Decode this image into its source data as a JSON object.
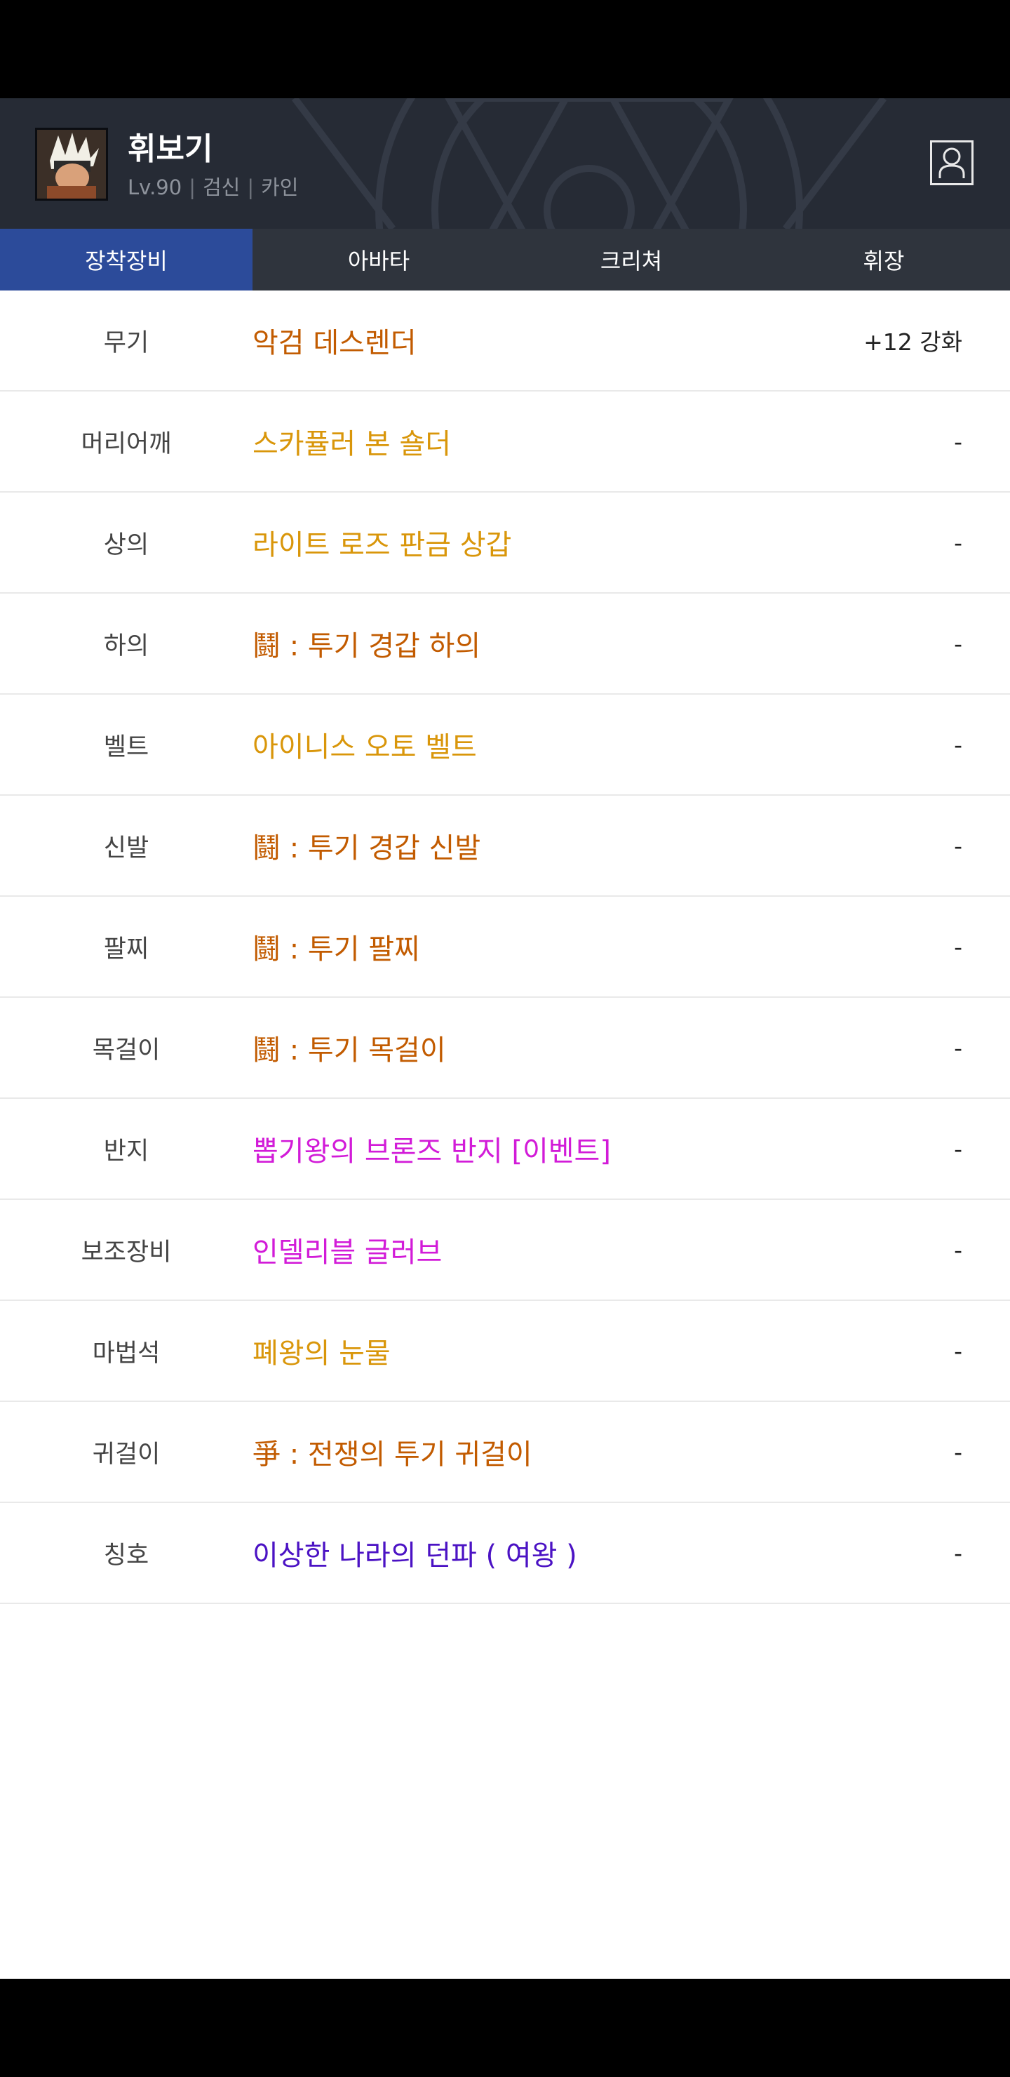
{
  "character": {
    "name": "휘보기",
    "level": "Lv.90",
    "class": "검신",
    "server": "카인",
    "separator": "|"
  },
  "tabs": [
    {
      "label": "장착장비",
      "active": true
    },
    {
      "label": "아바타",
      "active": false
    },
    {
      "label": "크리쳐",
      "active": false
    },
    {
      "label": "휘장",
      "active": false
    }
  ],
  "icons": {
    "avatar": "character-portrait",
    "profile_button": "person-icon"
  },
  "colors": {
    "epic_orange": "#c25b00",
    "legendary_gold": "#d9960a",
    "unique_magenta": "#d21bd8",
    "title_purple": "#4b12c4",
    "tab_active": "#2c4b9a"
  },
  "equipment": [
    {
      "slot": "무기",
      "item": "악검 데스렌더",
      "enhance": "+12 강화",
      "color": "#c25b00"
    },
    {
      "slot": "머리어깨",
      "item": "스카퓰러 본 숄더",
      "enhance": "-",
      "color": "#d9960a"
    },
    {
      "slot": "상의",
      "item": "라이트 로즈 판금 상갑",
      "enhance": "-",
      "color": "#d9960a"
    },
    {
      "slot": "하의",
      "item": "鬪 : 투기 경갑 하의",
      "enhance": "-",
      "color": "#c25b00"
    },
    {
      "slot": "벨트",
      "item": "아이니스 오토 벨트",
      "enhance": "-",
      "color": "#d9960a"
    },
    {
      "slot": "신발",
      "item": "鬪 : 투기 경갑 신발",
      "enhance": "-",
      "color": "#c25b00"
    },
    {
      "slot": "팔찌",
      "item": "鬪 : 투기 팔찌",
      "enhance": "-",
      "color": "#c25b00"
    },
    {
      "slot": "목걸이",
      "item": "鬪 : 투기 목걸이",
      "enhance": "-",
      "color": "#c25b00"
    },
    {
      "slot": "반지",
      "item": "뽑기왕의 브론즈 반지 [이벤트]",
      "enhance": "-",
      "color": "#d21bd8"
    },
    {
      "slot": "보조장비",
      "item": "인델리블 글러브",
      "enhance": "-",
      "color": "#d21bd8"
    },
    {
      "slot": "마법석",
      "item": "폐왕의 눈물",
      "enhance": "-",
      "color": "#d9960a"
    },
    {
      "slot": "귀걸이",
      "item": "爭 : 전쟁의 투기 귀걸이",
      "enhance": "-",
      "color": "#c25b00"
    },
    {
      "slot": "칭호",
      "item": "이상한 나라의 던파 ( 여왕 )",
      "enhance": "-",
      "color": "#4b12c4"
    }
  ]
}
